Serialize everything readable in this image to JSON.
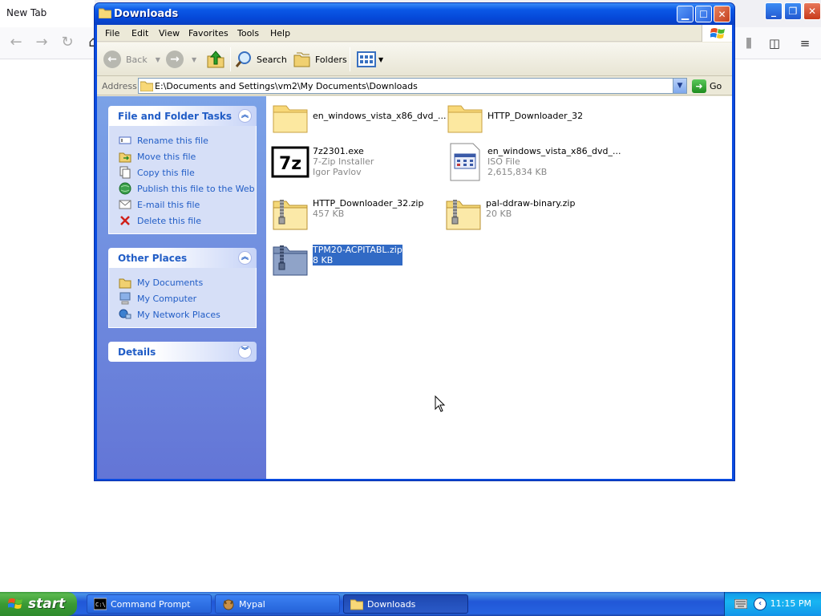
{
  "browser": {
    "tab_label": "New Tab"
  },
  "window": {
    "title": "Downloads",
    "menu": [
      "File",
      "Edit",
      "View",
      "Favorites",
      "Tools",
      "Help"
    ],
    "toolbar": {
      "back": "Back",
      "search": "Search",
      "folders": "Folders"
    },
    "address": {
      "label": "Address",
      "value": "E:\\Documents and Settings\\vm2\\My Documents\\Downloads",
      "go": "Go"
    }
  },
  "task_pane": {
    "file_tasks": {
      "title": "File and Folder Tasks",
      "items": [
        "Rename this file",
        "Move this file",
        "Copy this file",
        "Publish this file to the Web",
        "E-mail this file",
        "Delete this file"
      ]
    },
    "other_places": {
      "title": "Other Places",
      "items": [
        "My Documents",
        "My Computer",
        "My Network Places"
      ]
    },
    "details": {
      "title": "Details"
    }
  },
  "files": [
    {
      "name": "en_windows_vista_x86_dvd_...",
      "line2": "",
      "line3": "",
      "icon": "folder-icon"
    },
    {
      "name": "HTTP_Downloader_32",
      "line2": "",
      "line3": "",
      "icon": "folder-icon"
    },
    {
      "name": "7z2301.exe",
      "line2": "7-Zip Installer",
      "line3": "Igor Pavlov",
      "icon": "7zip-icon"
    },
    {
      "name": "en_windows_vista_x86_dvd_...",
      "line2": "ISO File",
      "line3": "2,615,834 KB",
      "icon": "iso-file-icon"
    },
    {
      "name": "HTTP_Downloader_32.zip",
      "line2": "457 KB",
      "line3": "",
      "icon": "zip-folder-icon"
    },
    {
      "name": "pal-ddraw-binary.zip",
      "line2": "20 KB",
      "line3": "",
      "icon": "zip-folder-icon"
    },
    {
      "name": "TPM20-ACPITABL.zip",
      "line2": "8 KB",
      "line3": "",
      "icon": "zip-folder-icon",
      "selected": true
    }
  ],
  "taskbar": {
    "start": "start",
    "buttons": [
      "Command Prompt",
      "Mypal",
      "Downloads"
    ],
    "active_button": "Downloads",
    "clock": "11:15 PM"
  },
  "colors": {
    "title_blue": "#0b58e6",
    "task_link": "#215dc6",
    "selection": "#316ac5",
    "start_green": "#3a9a34"
  }
}
